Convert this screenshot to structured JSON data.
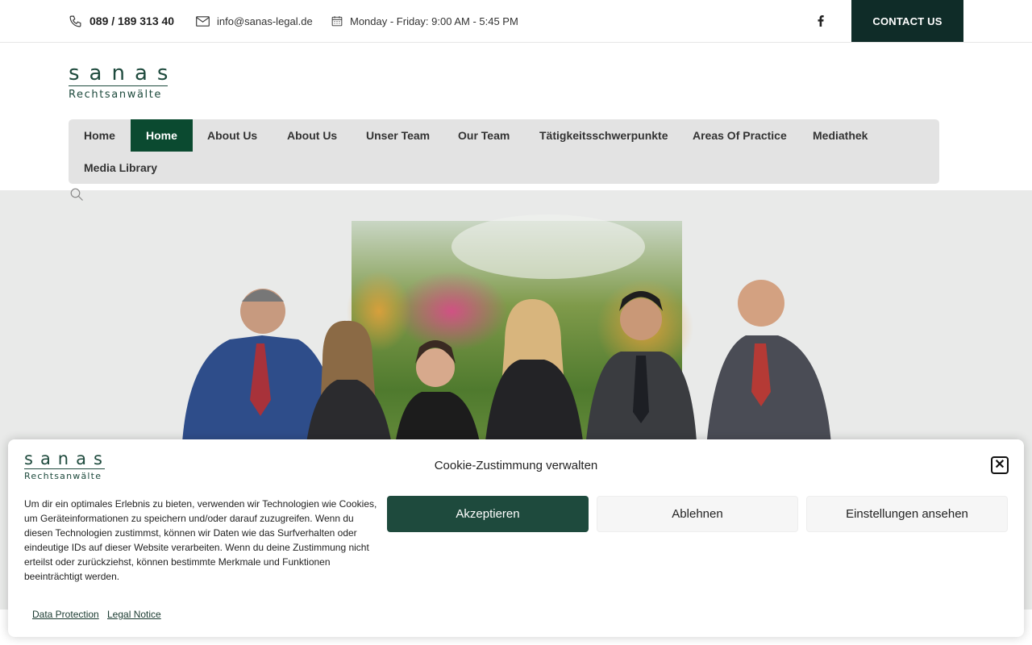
{
  "topbar": {
    "phone": "089 / 189 313 40",
    "email": "info@sanas-legal.de",
    "hours": "Monday - Friday: 9:00 AM - 5:45 PM",
    "social_icon": "facebook-icon",
    "contact_label": "CONTACT US"
  },
  "logo": {
    "word": "sanas",
    "subtitle": "Rechtsanwälte"
  },
  "nav": {
    "items": [
      {
        "label": "Home"
      },
      {
        "label": "Home",
        "active": true
      },
      {
        "label": "About Us"
      },
      {
        "label": "About Us"
      },
      {
        "label": "Unser Team"
      },
      {
        "label": "Our Team"
      },
      {
        "label": "Tätigkeitsschwerpunkte"
      },
      {
        "label": "Areas Of Practice"
      },
      {
        "label": "Mediathek"
      },
      {
        "label": "Media Library"
      }
    ],
    "search_icon": "search-icon"
  },
  "cookie": {
    "title": "Cookie-Zustimmung verwalten",
    "text": "Um dir ein optimales Erlebnis zu bieten, verwenden wir Technologien wie Cookies, um Geräteinformationen zu speichern und/oder darauf zuzugreifen. Wenn du diesen Technologien zustimmst, können wir Daten wie das Surfverhalten oder eindeutige IDs auf dieser Website verarbeiten. Wenn du deine Zustimmung nicht erteilst oder zurückziehst, können bestimmte Merkmale und Funktionen beeinträchtigt werden.",
    "accept": "Akzeptieren",
    "deny": "Ablehnen",
    "preferences": "Einstellungen ansehen",
    "links": [
      "Data Protection",
      "Legal Notice"
    ],
    "close_icon": "close-icon"
  },
  "colors": {
    "brand_dark": "#0f2c28",
    "brand_green": "#1e4a3d",
    "nav_active": "#0b4a30",
    "nav_bg": "#e3e3e3"
  }
}
